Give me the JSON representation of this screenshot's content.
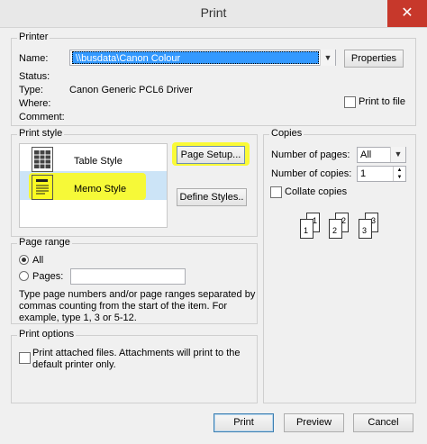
{
  "window": {
    "title": "Print",
    "close": "✕"
  },
  "printer": {
    "group_label": "Printer",
    "name_label": "Name:",
    "name_value": "\\\\busdata\\Canon Colour",
    "properties_button": "Properties",
    "status_label": "Status:",
    "status_value": "",
    "type_label": "Type:",
    "type_value": "Canon Generic PCL6 Driver",
    "where_label": "Where:",
    "where_value": "",
    "comment_label": "Comment:",
    "comment_value": "",
    "print_to_file": "Print to file"
  },
  "print_style": {
    "group_label": "Print style",
    "styles": [
      "Table Style",
      "Memo Style"
    ],
    "selected": "Memo Style",
    "page_setup_button": "Page Setup...",
    "define_styles_button": "Define Styles.."
  },
  "copies": {
    "group_label": "Copies",
    "number_of_pages_label": "Number of pages:",
    "number_of_pages_value": "All",
    "number_of_copies_label": "Number of copies:",
    "number_of_copies_value": "1",
    "collate_label": "Collate copies",
    "collate_digits": [
      "1",
      "1",
      "2",
      "2",
      "3",
      "3"
    ]
  },
  "page_range": {
    "group_label": "Page range",
    "all_label": "All",
    "pages_label": "Pages:",
    "pages_value": "",
    "help_text_1": "Type page numbers and/or page ranges separated by",
    "help_text_2": "commas counting from the start of the item. For",
    "help_text_3": "example, type 1, 3 or 5-12."
  },
  "print_options": {
    "group_label": "Print options",
    "attached_line_1": "Print attached files.  Attachments will print to the",
    "attached_line_2": "default printer only."
  },
  "footer": {
    "print_button": "Print",
    "preview_button": "Preview",
    "cancel_button": "Cancel"
  },
  "colors": {
    "highlight": "#fbfb22",
    "selection": "#3399ff",
    "close": "#c7382b"
  }
}
